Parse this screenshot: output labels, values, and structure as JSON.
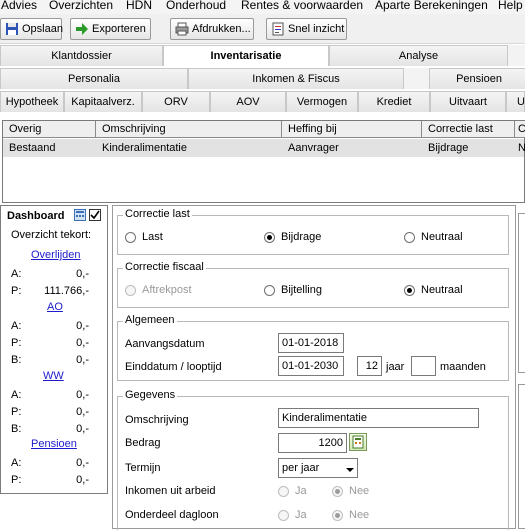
{
  "menu": [
    "Advies",
    "Overzichten",
    "HDN",
    "Onderhoud",
    "Rentes & voorwaarden",
    "Aparte Berekeningen",
    "Help"
  ],
  "toolbar": {
    "save": "Opslaan",
    "export": "Exporteren",
    "print": "Afdrukken...",
    "quick": "Snel inzicht"
  },
  "tabs_main": [
    "Klantdossier",
    "Inventarisatie",
    "Analyse"
  ],
  "tabs_sub": [
    "Personalia",
    "Inkomen & Fiscus",
    "Pensioen"
  ],
  "tabs_third": [
    "Hypotheek",
    "Kapitaalverz.",
    "ORV",
    "AOV",
    "Vermogen",
    "Krediet",
    "Uitvaart",
    "U"
  ],
  "grid": {
    "headers": [
      "Overig",
      "Omschrijving",
      "Heffing bij",
      "Correctie last",
      "C"
    ],
    "row": [
      "Bestaand",
      "Kinderalimentatie",
      "Aanvrager",
      "Bijdrage",
      "N"
    ]
  },
  "dashboard": {
    "title": "Dashboard",
    "subtitle": "Overzicht tekort:",
    "overlijden": {
      "title": "Overlijden",
      "a": "0,-",
      "p": "111.766,-"
    },
    "ao": {
      "title": "AO",
      "a": "0,-",
      "p": "0,-",
      "b": "0,-"
    },
    "ww": {
      "title": "WW",
      "a": "0,-",
      "p": "0,-",
      "b": "0,-"
    },
    "pensioen": {
      "title": "Pensioen",
      "a": "0,-",
      "p": "0,-"
    },
    "labels": {
      "a": "A:",
      "p": "P:",
      "b": "B:"
    }
  },
  "correctie_last": {
    "title": "Correctie last",
    "options": [
      "Last",
      "Bijdrage",
      "Neutraal"
    ],
    "selected": "Bijdrage"
  },
  "correctie_fiscaal": {
    "title": "Correctie fiscaal",
    "options": [
      "Aftrekpost",
      "Bijtelling",
      "Neutraal"
    ],
    "selected": "Neutraal"
  },
  "algemeen": {
    "title": "Algemeen",
    "start_label": "Aanvangsdatum",
    "start_value": "01-01-2018",
    "end_label": "Einddatum / looptijd",
    "end_value": "01-01-2030",
    "years_value": "12",
    "years_unit": "jaar",
    "months_value": "",
    "months_unit": "maanden"
  },
  "gegevens": {
    "title": "Gegevens",
    "omschrijving_label": "Omschrijving",
    "omschrijving_value": "Kinderalimentatie",
    "bedrag_label": "Bedrag",
    "bedrag_value": "1200",
    "termijn_label": "Termijn",
    "termijn_value": "per jaar",
    "inkomen_label": "Inkomen uit arbeid",
    "onderdeel_label": "Onderdeel dagloon",
    "ja": "Ja",
    "nee": "Nee"
  },
  "colors": {
    "link": "#1c1ccc",
    "active_tab": "#ffffff",
    "selected_row": "#e2e2e2"
  }
}
